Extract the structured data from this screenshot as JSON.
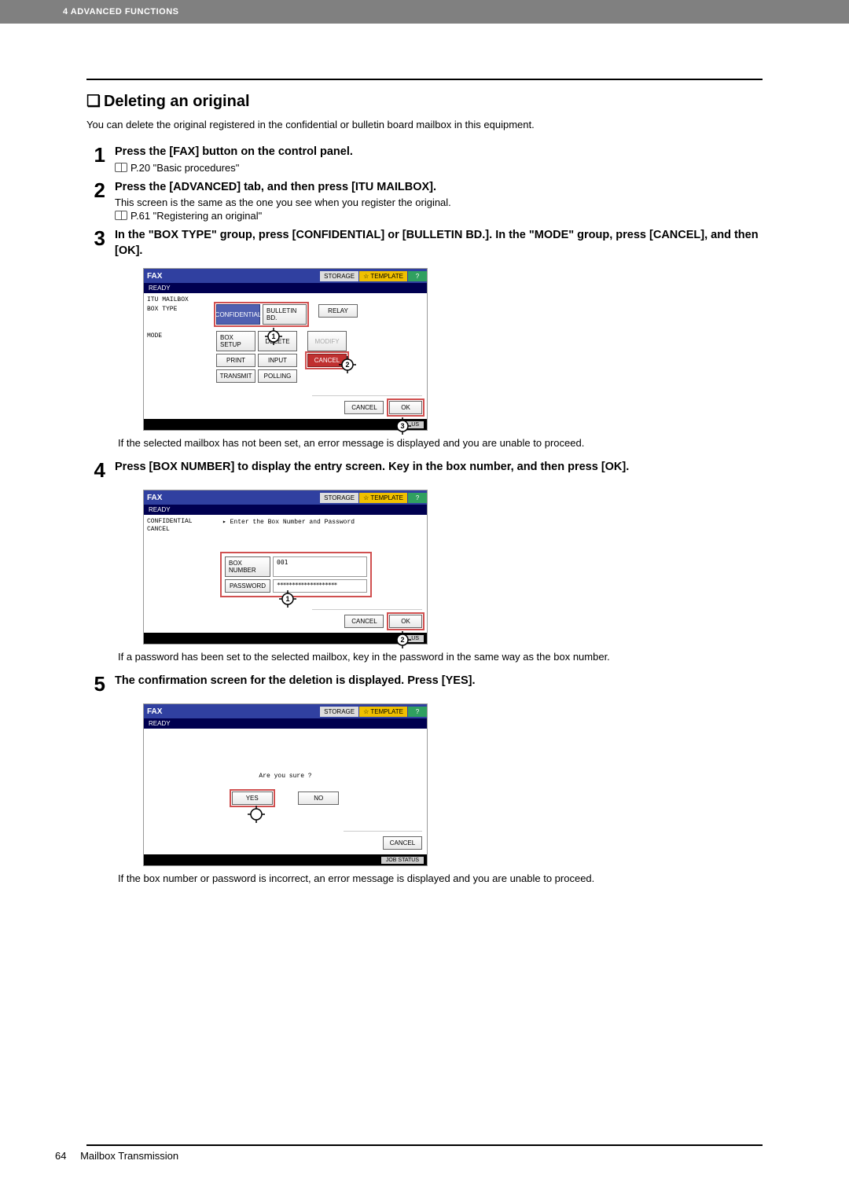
{
  "header": "4 ADVANCED FUNCTIONS",
  "section_title": "Deleting an original",
  "intro": "You can delete the original registered in the confidential or bulletin board mailbox in this equipment.",
  "steps": {
    "1": {
      "head": "Press the [FAX] button on the control panel.",
      "ref": "P.20 \"Basic procedures\""
    },
    "2": {
      "head": "Press the [ADVANCED] tab, and then press [ITU MAILBOX].",
      "sub": "This screen is the same as the one you see when you register the original.",
      "ref": "P.61 \"Registering an original\""
    },
    "3": {
      "head": "In the \"BOX TYPE\" group, press [CONFIDENTIAL] or [BULLETIN BD.]. In the \"MODE\" group, press [CANCEL], and then [OK].",
      "note": "If the selected mailbox has not been set, an error message is displayed and you are unable to proceed."
    },
    "4": {
      "head": "Press [BOX NUMBER] to display the entry screen. Key in the box number, and then press [OK].",
      "note": "If a password has been set to the selected mailbox, key in the password in the same way as the box number."
    },
    "5": {
      "head": "The confirmation screen for the deletion is displayed. Press [YES].",
      "note": "If the box number or password is incorrect, an error message is displayed and you are unable to proceed."
    }
  },
  "screenshot_common": {
    "fax": "FAX",
    "storage": "STORAGE",
    "template": "TEMPLATE",
    "help": "?",
    "ready": "READY",
    "job_status": "JOB STATUS",
    "us": "US"
  },
  "shot3": {
    "itu_mailbox": "ITU MAILBOX",
    "box_type": "BOX TYPE",
    "mode": "MODE",
    "confidential": "CONFIDENTIAL",
    "bulletin": "BULLETIN BD.",
    "relay": "RELAY",
    "box_setup": "BOX SETUP",
    "delete": "DELETE",
    "modify": "MODIFY",
    "print": "PRINT",
    "input": "INPUT",
    "cancel_btn": "CANCEL",
    "transmit": "TRANSMIT",
    "polling": "POLLING",
    "cancel": "CANCEL",
    "ok": "OK"
  },
  "shot4": {
    "context1": "CONFIDENTIAL",
    "context2": "CANCEL",
    "prompt": "▸ Enter the Box Number and Password",
    "box_number": "BOX NUMBER",
    "password": "PASSWORD",
    "box_value": "001",
    "pw_value": "********************",
    "cancel": "CANCEL",
    "ok": "OK"
  },
  "shot5": {
    "prompt": "Are you sure ?",
    "yes": "YES",
    "no": "NO",
    "cancel": "CANCEL"
  },
  "footer": {
    "page_number": "64",
    "section": "Mailbox Transmission"
  }
}
